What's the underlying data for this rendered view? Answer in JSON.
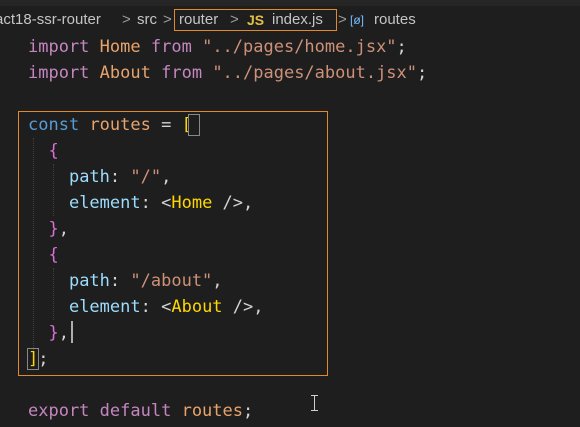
{
  "breadcrumb": {
    "project": "act18-ssr-router",
    "folder": "src",
    "subfolder": "router",
    "file_icon": "JS",
    "file": "index.js",
    "symbol_icon": "[ø]",
    "symbol": "routes",
    "separator": ">"
  },
  "code": {
    "line1": {
      "kw1": "import",
      "name": "Home",
      "kw2": "from",
      "path": "\"../pages/home.jsx\"",
      "semi": ";"
    },
    "line2": {
      "kw1": "import",
      "name": "About",
      "kw2": "from",
      "path": "\"../pages/about.jsx\"",
      "semi": ";"
    },
    "line4": {
      "kw": "const",
      "name": "routes",
      "eq": "=",
      "bracket": "["
    },
    "line5": {
      "brace": "{"
    },
    "line6": {
      "key": "path",
      "colon": ":",
      "value": "\"/\"",
      "comma": ","
    },
    "line7": {
      "key": "element",
      "colon": ":",
      "open": "<",
      "tag": "Home",
      "close": " />",
      "comma": ","
    },
    "line8": {
      "brace": "}",
      "comma": ","
    },
    "line9": {
      "brace": "{"
    },
    "line10": {
      "key": "path",
      "colon": ":",
      "value": "\"/about\"",
      "comma": ","
    },
    "line11": {
      "key": "element",
      "colon": ":",
      "open": "<",
      "tag": "About",
      "close": " />",
      "comma": ","
    },
    "line12": {
      "brace": "}",
      "comma": ","
    },
    "line13": {
      "bracket": "]",
      "semi": ";"
    },
    "line15": {
      "kw1": "export",
      "kw2": "default",
      "name": "routes",
      "semi": ";"
    }
  },
  "colors": {
    "background": "#1e1e1e",
    "highlight_border": "#e08a2c",
    "keyword": "#c586c0",
    "string": "#ce9178",
    "variable": "#9cdcfe"
  }
}
